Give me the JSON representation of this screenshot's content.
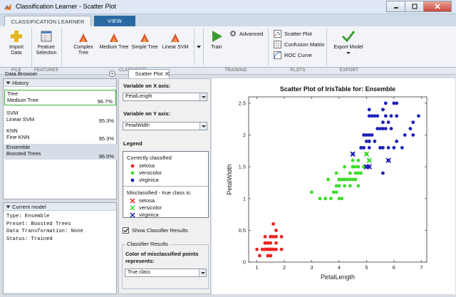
{
  "window": {
    "title": "Classification Learner - Scatter Plot"
  },
  "ribbon_tabs": [
    "CLASSIFICATION LEARNER",
    "VIEW"
  ],
  "ribbon": {
    "import_data": "Import\nData",
    "feature_selection": "Feature\nSelection",
    "classifiers": [
      "Complex\nTree",
      "Medium Tree",
      "Simple Tree",
      "Linear SVM"
    ],
    "train": "Train",
    "advanced": "Advanced",
    "scatter_plot": "Scatter Plot",
    "confusion_matrix": "Confusion Matrix",
    "roc_curve": "ROC Curve",
    "export_model": "Export Model",
    "groups": [
      "FILE",
      "FEATURES",
      "CLASSIFIER",
      "TRAINING",
      "PLOTS",
      "EXPORT"
    ]
  },
  "data_browser": {
    "title": "Data Browser",
    "history_header": "History",
    "history": [
      {
        "type": "Tree",
        "preset": "Medium Tree",
        "accuracy": "96.7%"
      },
      {
        "type": "SVM",
        "preset": "Linear SVM",
        "accuracy": "95.3%"
      },
      {
        "type": "KNN",
        "preset": "Fine KNN",
        "accuracy": "95.3%"
      },
      {
        "type": "Ensemble",
        "preset": "Boosted Trees",
        "accuracy": "96.0%"
      }
    ],
    "current_model_header": "Current model",
    "current_model": "Type: Ensemble\nPreset: Boosted Trees\nData Transformation: None\nStatus: Trained"
  },
  "doc_tab": "Scatter Plot",
  "controls": {
    "x_label": "Variable on X axis:",
    "x_value": "PetalLength",
    "y_label": "Variable on Y axis:",
    "y_value": "PetalWidth",
    "legend_label": "Legend",
    "correct_header": "Correctly classified",
    "classes": [
      "setosa",
      "versicolor",
      "virginica"
    ],
    "misclass_header": "Misclassified - true class is:",
    "show_results_label": "Show Classifier Results",
    "show_results_checked": true,
    "results_group": "Classifier Results",
    "color_label": "Color of misclassified points represents:",
    "color_value": "True class"
  },
  "colors": {
    "setosa": "#e8231f",
    "versicolor": "#3cdc2c",
    "virginica": "#1d1fb8",
    "accent": "#2a6aa3"
  },
  "chart_data": {
    "type": "scatter",
    "title": "Scatter Plot of IrisTable for: Ensemble",
    "xlabel": "PetalLength",
    "ylabel": "PetalWidth",
    "xlim": [
      0.7,
      7.2
    ],
    "ylim": [
      0,
      2.6
    ],
    "xticks": [
      1,
      2,
      3,
      4,
      5,
      6,
      7
    ],
    "yticks": [
      0,
      0.5,
      1,
      1.5,
      2,
      2.5
    ],
    "grid": false,
    "series": [
      {
        "name": "setosa",
        "marker": "dot",
        "points": [
          [
            1.4,
            0.2
          ],
          [
            1.4,
            0.2
          ],
          [
            1.3,
            0.2
          ],
          [
            1.5,
            0.2
          ],
          [
            1.4,
            0.2
          ],
          [
            1.7,
            0.4
          ],
          [
            1.4,
            0.3
          ],
          [
            1.5,
            0.2
          ],
          [
            1.4,
            0.2
          ],
          [
            1.5,
            0.1
          ],
          [
            1.5,
            0.2
          ],
          [
            1.6,
            0.2
          ],
          [
            1.4,
            0.1
          ],
          [
            1.1,
            0.1
          ],
          [
            1.2,
            0.2
          ],
          [
            1.5,
            0.4
          ],
          [
            1.3,
            0.4
          ],
          [
            1.4,
            0.3
          ],
          [
            1.7,
            0.3
          ],
          [
            1.5,
            0.3
          ],
          [
            1.7,
            0.2
          ],
          [
            1.5,
            0.4
          ],
          [
            1.0,
            0.2
          ],
          [
            1.7,
            0.5
          ],
          [
            1.9,
            0.2
          ],
          [
            1.6,
            0.2
          ],
          [
            1.6,
            0.4
          ],
          [
            1.5,
            0.2
          ],
          [
            1.4,
            0.2
          ],
          [
            1.6,
            0.2
          ],
          [
            1.6,
            0.2
          ],
          [
            1.5,
            0.4
          ],
          [
            1.5,
            0.1
          ],
          [
            1.4,
            0.2
          ],
          [
            1.5,
            0.2
          ],
          [
            1.2,
            0.2
          ],
          [
            1.3,
            0.2
          ],
          [
            1.4,
            0.1
          ],
          [
            1.3,
            0.2
          ],
          [
            1.5,
            0.2
          ],
          [
            1.3,
            0.3
          ],
          [
            1.3,
            0.3
          ],
          [
            1.3,
            0.2
          ],
          [
            1.6,
            0.6
          ],
          [
            1.9,
            0.4
          ],
          [
            1.4,
            0.3
          ],
          [
            1.6,
            0.2
          ],
          [
            1.4,
            0.2
          ],
          [
            1.5,
            0.2
          ],
          [
            1.4,
            0.2
          ]
        ]
      },
      {
        "name": "versicolor",
        "marker": "dot",
        "points": [
          [
            4.7,
            1.4
          ],
          [
            4.5,
            1.5
          ],
          [
            4.9,
            1.5
          ],
          [
            4.0,
            1.3
          ],
          [
            4.6,
            1.5
          ],
          [
            4.5,
            1.3
          ],
          [
            4.7,
            1.6
          ],
          [
            3.3,
            1.0
          ],
          [
            4.6,
            1.3
          ],
          [
            3.9,
            1.4
          ],
          [
            3.5,
            1.0
          ],
          [
            4.2,
            1.5
          ],
          [
            4.0,
            1.0
          ],
          [
            4.7,
            1.4
          ],
          [
            3.6,
            1.3
          ],
          [
            4.4,
            1.4
          ],
          [
            4.5,
            1.5
          ],
          [
            4.1,
            1.0
          ],
          [
            4.5,
            1.5
          ],
          [
            3.9,
            1.1
          ],
          [
            4.0,
            1.3
          ],
          [
            4.9,
            1.5
          ],
          [
            4.7,
            1.2
          ],
          [
            4.3,
            1.3
          ],
          [
            4.4,
            1.4
          ],
          [
            4.8,
            1.4
          ],
          [
            5.0,
            1.7
          ],
          [
            4.5,
            1.5
          ],
          [
            3.5,
            1.0
          ],
          [
            3.8,
            1.1
          ],
          [
            3.7,
            1.0
          ],
          [
            3.9,
            1.2
          ],
          [
            5.1,
            1.6
          ],
          [
            4.5,
            1.5
          ],
          [
            4.5,
            1.6
          ],
          [
            4.7,
            1.5
          ],
          [
            4.4,
            1.3
          ],
          [
            4.1,
            1.3
          ],
          [
            4.0,
            1.3
          ],
          [
            4.4,
            1.2
          ],
          [
            4.6,
            1.4
          ],
          [
            4.0,
            1.2
          ],
          [
            3.3,
            1.0
          ],
          [
            4.2,
            1.3
          ],
          [
            4.2,
            1.2
          ],
          [
            4.2,
            1.3
          ],
          [
            4.3,
            1.3
          ],
          [
            3.0,
            1.1
          ],
          [
            4.1,
            1.3
          ],
          [
            4.8,
            1.8
          ]
        ]
      },
      {
        "name": "virginica",
        "marker": "dot",
        "points": [
          [
            6.0,
            2.5
          ],
          [
            5.1,
            1.9
          ],
          [
            5.9,
            2.1
          ],
          [
            5.6,
            1.8
          ],
          [
            5.8,
            2.2
          ],
          [
            6.6,
            2.1
          ],
          [
            4.5,
            1.7
          ],
          [
            6.3,
            1.8
          ],
          [
            5.8,
            1.8
          ],
          [
            6.1,
            2.5
          ],
          [
            5.1,
            2.0
          ],
          [
            5.3,
            1.9
          ],
          [
            5.5,
            2.1
          ],
          [
            5.0,
            2.0
          ],
          [
            5.1,
            2.4
          ],
          [
            5.3,
            2.3
          ],
          [
            5.5,
            1.8
          ],
          [
            6.7,
            2.2
          ],
          [
            6.9,
            2.3
          ],
          [
            5.0,
            1.5
          ],
          [
            5.7,
            2.3
          ],
          [
            4.9,
            2.0
          ],
          [
            6.7,
            2.0
          ],
          [
            4.9,
            1.8
          ],
          [
            5.7,
            2.1
          ],
          [
            6.0,
            1.8
          ],
          [
            4.8,
            1.8
          ],
          [
            4.9,
            1.8
          ],
          [
            5.6,
            2.1
          ],
          [
            5.8,
            1.6
          ],
          [
            6.1,
            1.9
          ],
          [
            6.4,
            2.0
          ],
          [
            5.6,
            2.2
          ],
          [
            5.1,
            1.5
          ],
          [
            5.6,
            1.4
          ],
          [
            6.1,
            2.3
          ],
          [
            5.6,
            2.4
          ],
          [
            5.5,
            1.8
          ],
          [
            4.8,
            1.8
          ],
          [
            5.4,
            2.1
          ],
          [
            5.6,
            2.4
          ],
          [
            5.1,
            2.3
          ],
          [
            5.1,
            1.9
          ],
          [
            5.9,
            2.3
          ],
          [
            5.7,
            2.5
          ],
          [
            5.2,
            2.3
          ],
          [
            5.0,
            1.9
          ],
          [
            5.2,
            2.0
          ],
          [
            5.4,
            2.3
          ],
          [
            5.1,
            1.8
          ]
        ]
      },
      {
        "name": "setosa (misclassified)",
        "marker": "x",
        "points": []
      },
      {
        "name": "versicolor (misclassified)",
        "marker": "x",
        "points": [
          [
            5.1,
            1.6
          ],
          [
            5.0,
            1.7
          ]
        ]
      },
      {
        "name": "virginica (misclassified)",
        "marker": "x",
        "points": [
          [
            4.5,
            1.7
          ],
          [
            5.0,
            1.5
          ],
          [
            5.8,
            1.6
          ],
          [
            5.1,
            1.5
          ]
        ]
      }
    ]
  }
}
